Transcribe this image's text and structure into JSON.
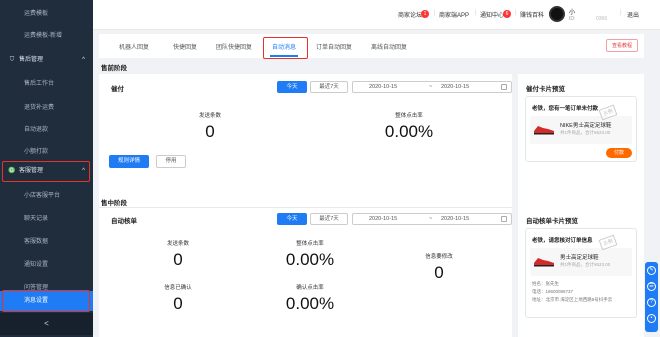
{
  "sidebar": {
    "items": [
      {
        "label": "运费模板"
      },
      {
        "label": "运费模板-新增"
      },
      {
        "label": "售后管理",
        "icon": "shield-icon"
      },
      {
        "label": "售后工作台"
      },
      {
        "label": "退货补运费"
      },
      {
        "label": "自动退款"
      },
      {
        "label": "小额打款"
      },
      {
        "label": "客服管理",
        "icon": "headset-icon"
      },
      {
        "label": "小店客服平台"
      },
      {
        "label": "聊天记录"
      },
      {
        "label": "客服数据"
      },
      {
        "label": "通知设置"
      },
      {
        "label": "问答管理"
      },
      {
        "label": "消息设置"
      }
    ],
    "collapse": "<"
  },
  "topbar": {
    "links": [
      {
        "label": "商家论坛",
        "badge": "1"
      },
      {
        "label": "商家端APP"
      },
      {
        "label": "通知中心",
        "badge": "6"
      },
      {
        "label": "赚钱百科"
      }
    ],
    "shop_name": "小",
    "shop_id_label": "ID:",
    "shop_id_tail": "0366",
    "logout": "退出"
  },
  "tabs": [
    "机器人回复",
    "快捷回复",
    "团队快捷回复",
    "自动消息",
    "订单自动回复",
    "离线自动回复"
  ],
  "active_tab": "自动消息",
  "help_button": "查看教程",
  "presale": {
    "stage_title": "售前阶段",
    "section_title": "催付",
    "today": "今天",
    "last7": "最近7天",
    "date_from": "2020-10-15",
    "date_sep": "~",
    "date_to": "2020-10-15",
    "stats": [
      {
        "label": "发送条数",
        "value": "0"
      },
      {
        "label": "整体点击率",
        "value": "0.00%"
      }
    ],
    "rules_button": "规则详情",
    "stop_button": "停用",
    "preview_title": "催付卡片预览",
    "preview_message": "老铁，您有一笔订单未付款",
    "product_name": "NIKE男士高定足球鞋",
    "product_meta": "共1件商品，合计¥523.00",
    "stamp": "示例",
    "pay_button": "付款"
  },
  "midsale": {
    "stage_title": "售中阶段",
    "section_title": "自动核单",
    "today": "今天",
    "last7": "最近7天",
    "date_from": "2020-10-15",
    "date_sep": "~",
    "date_to": "2020-10-15",
    "stats": [
      {
        "label": "发送条数",
        "value": "0"
      },
      {
        "label": "整体点击率",
        "value": "0.00%"
      },
      {
        "label": "信息要修改",
        "value": "0"
      },
      {
        "label": "信息已确认",
        "value": "0"
      },
      {
        "label": "确认点击率",
        "value": "0.00%"
      }
    ],
    "preview_title": "自动核单卡片预览",
    "preview_message": "老铁，请您核对订单信息",
    "product_name": "男士高定足球鞋",
    "product_meta": "共1件商品，合计¥523.00",
    "stamp": "示例",
    "info_lines": [
      "姓名：张先生",
      "电话：18600086737",
      "地址：北京市 海淀区上地西路8号抖手云"
    ]
  },
  "colors": {
    "accent": "#1f7cf5",
    "sidebar": "#1f2d3d",
    "highlight": "#e5332a",
    "pay": "#ff6a00"
  }
}
